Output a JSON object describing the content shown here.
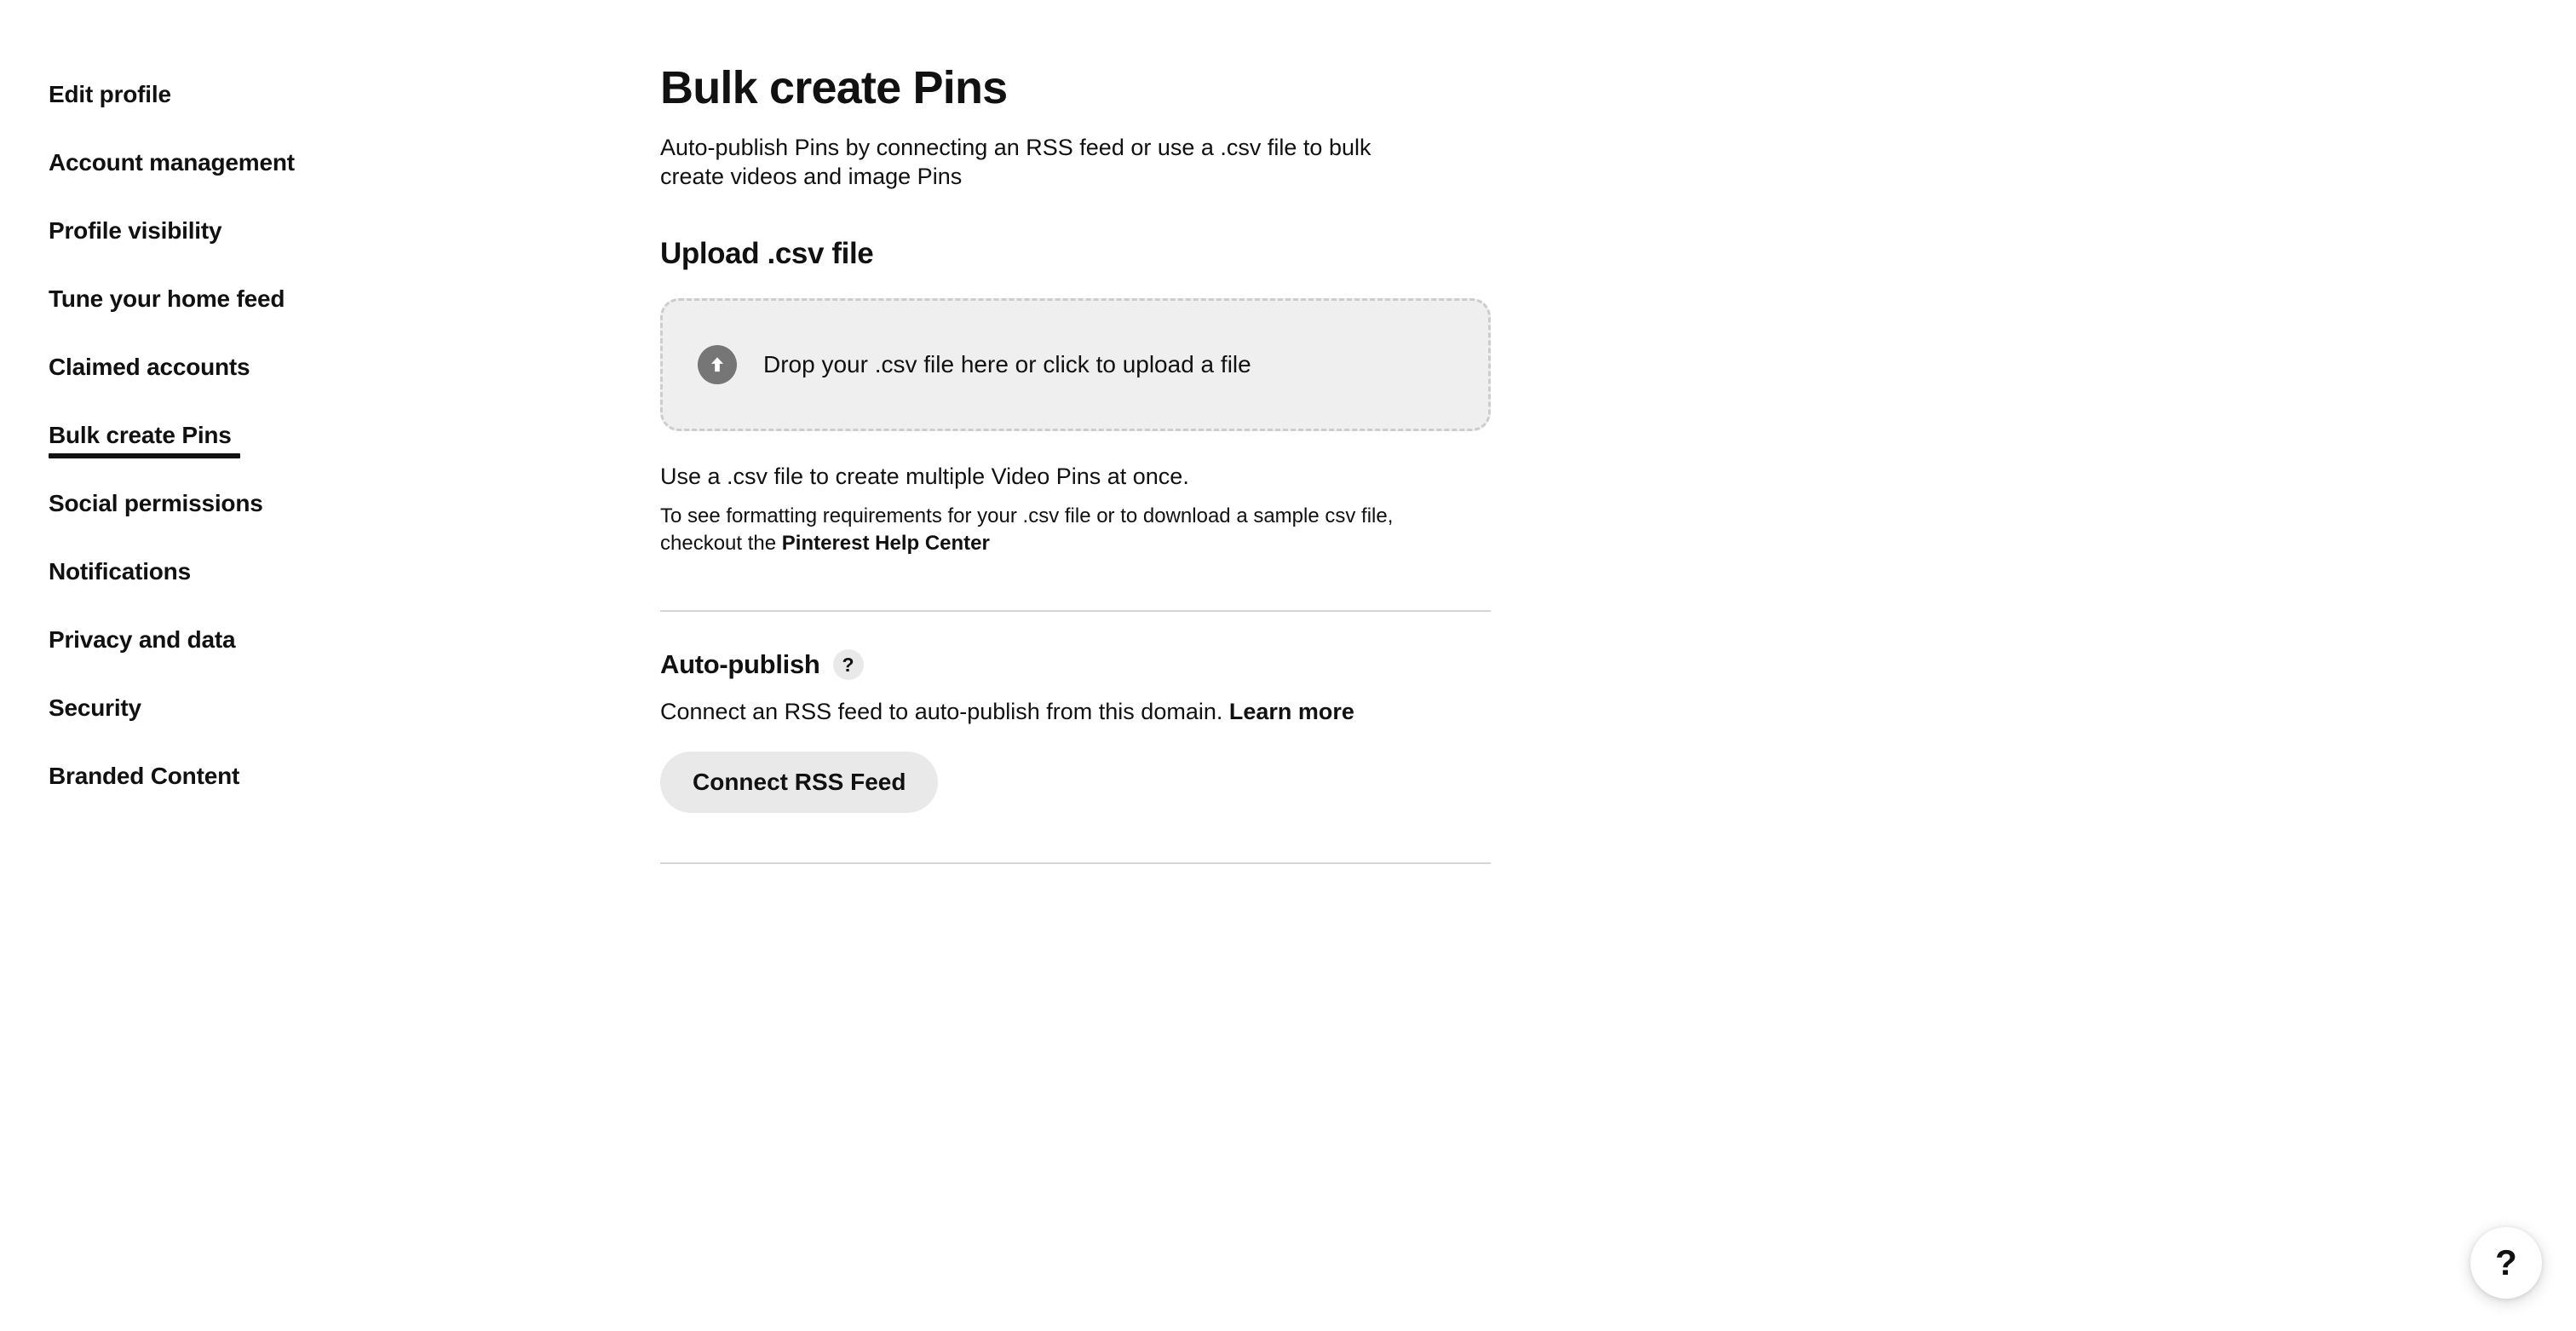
{
  "sidebar": {
    "items": [
      {
        "label": "Edit profile",
        "active": false
      },
      {
        "label": "Account management",
        "active": false
      },
      {
        "label": "Profile visibility",
        "active": false
      },
      {
        "label": "Tune your home feed",
        "active": false
      },
      {
        "label": "Claimed accounts",
        "active": false
      },
      {
        "label": "Bulk create Pins",
        "active": true
      },
      {
        "label": "Social permissions",
        "active": false
      },
      {
        "label": "Notifications",
        "active": false
      },
      {
        "label": "Privacy and data",
        "active": false
      },
      {
        "label": "Security",
        "active": false
      },
      {
        "label": "Branded Content",
        "active": false
      }
    ]
  },
  "main": {
    "title": "Bulk create Pins",
    "subtitle": "Auto-publish Pins by connecting an RSS feed or use a .csv file to bulk create videos and image Pins",
    "upload": {
      "heading": "Upload .csv file",
      "dropzone_label": "Drop your .csv file here or click to upload a file",
      "upload_icon": "upload-arrow-icon",
      "help_primary": "Use a .csv file to create multiple Video Pins at once.",
      "help_secondary_prefix": "To see formatting requirements for your .csv file or to download a sample csv file, checkout the ",
      "help_secondary_link": "Pinterest Help Center"
    },
    "autopublish": {
      "heading": "Auto-publish",
      "info_badge": "?",
      "description_prefix": "Connect an RSS feed to auto-publish from this domain. ",
      "description_link": "Learn more",
      "button_label": "Connect RSS Feed"
    }
  },
  "floating": {
    "help_label": "?",
    "help_icon": "question-mark-icon"
  },
  "colors": {
    "text": "#111111",
    "dropzone_bg": "#efefef",
    "dropzone_border": "#cdcdcd",
    "button_bg": "#e9e9e9",
    "divider": "#d6d6d6",
    "upload_icon_bg": "#767676"
  }
}
